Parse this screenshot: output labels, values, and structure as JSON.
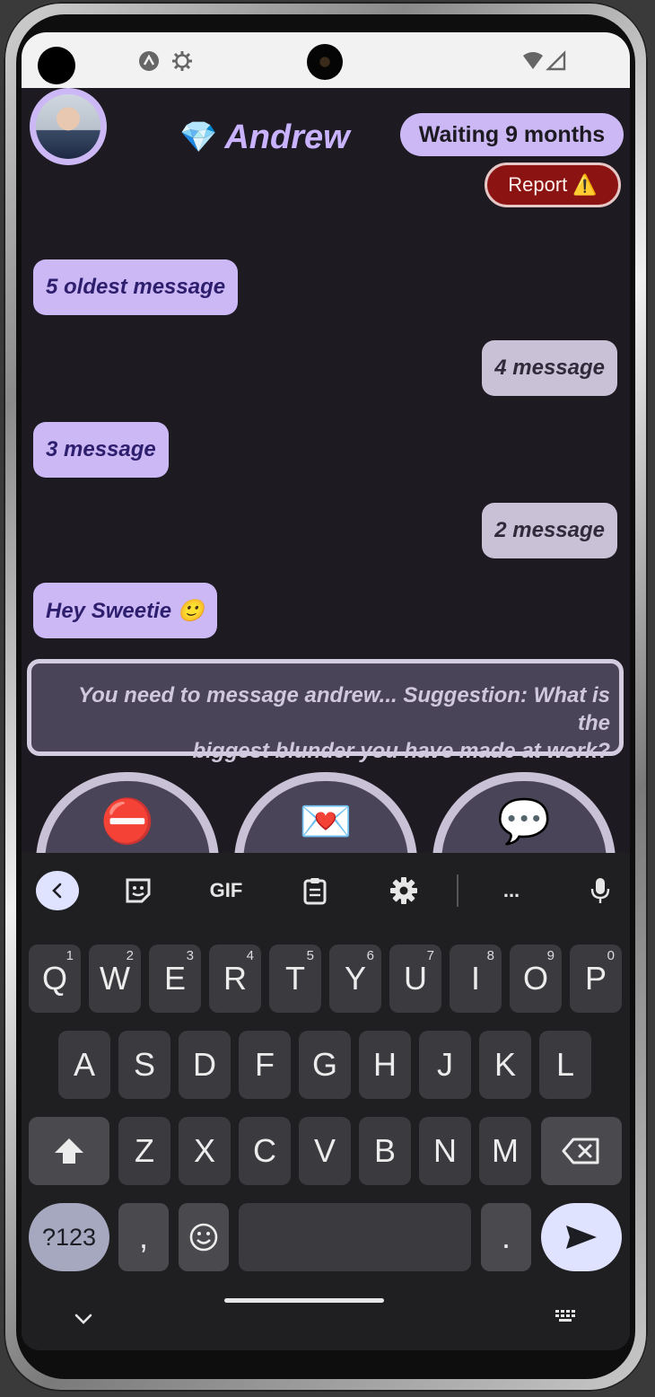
{
  "header": {
    "contact_name": "Andrew",
    "gem_emoji": "💎",
    "waiting_label": "Waiting 9 months",
    "report_label": "Report",
    "report_emoji": "⚠️"
  },
  "messages": [
    {
      "text": "5 oldest message",
      "side": "left"
    },
    {
      "text": "4 message",
      "side": "right"
    },
    {
      "text": "3 message",
      "side": "left"
    },
    {
      "text": "2 message",
      "side": "right"
    },
    {
      "text": "Hey Sweetie 🙂",
      "side": "left"
    }
  ],
  "suggestion": {
    "line1": "You need to message andrew... Suggestion: What is the",
    "line2": "biggest blunder you have made at work?"
  },
  "actions": [
    {
      "emoji": "⛔",
      "icon": "no-entry-icon"
    },
    {
      "emoji": "💌",
      "icon": "love-letter-icon"
    },
    {
      "emoji": "💬",
      "icon": "speech-bubble-icon"
    }
  ],
  "keyboard": {
    "toolbar": {
      "gif_label": "GIF",
      "more_label": "..."
    },
    "row1": [
      {
        "k": "Q",
        "h": "1"
      },
      {
        "k": "W",
        "h": "2"
      },
      {
        "k": "E",
        "h": "3"
      },
      {
        "k": "R",
        "h": "4"
      },
      {
        "k": "T",
        "h": "5"
      },
      {
        "k": "Y",
        "h": "6"
      },
      {
        "k": "U",
        "h": "7"
      },
      {
        "k": "I",
        "h": "8"
      },
      {
        "k": "O",
        "h": "9"
      },
      {
        "k": "P",
        "h": "0"
      }
    ],
    "row2": [
      "A",
      "S",
      "D",
      "F",
      "G",
      "H",
      "J",
      "K",
      "L"
    ],
    "row3": [
      "Z",
      "X",
      "C",
      "V",
      "B",
      "N",
      "M"
    ],
    "symbols_label": "?123",
    "comma_label": ",",
    "period_label": "."
  }
}
